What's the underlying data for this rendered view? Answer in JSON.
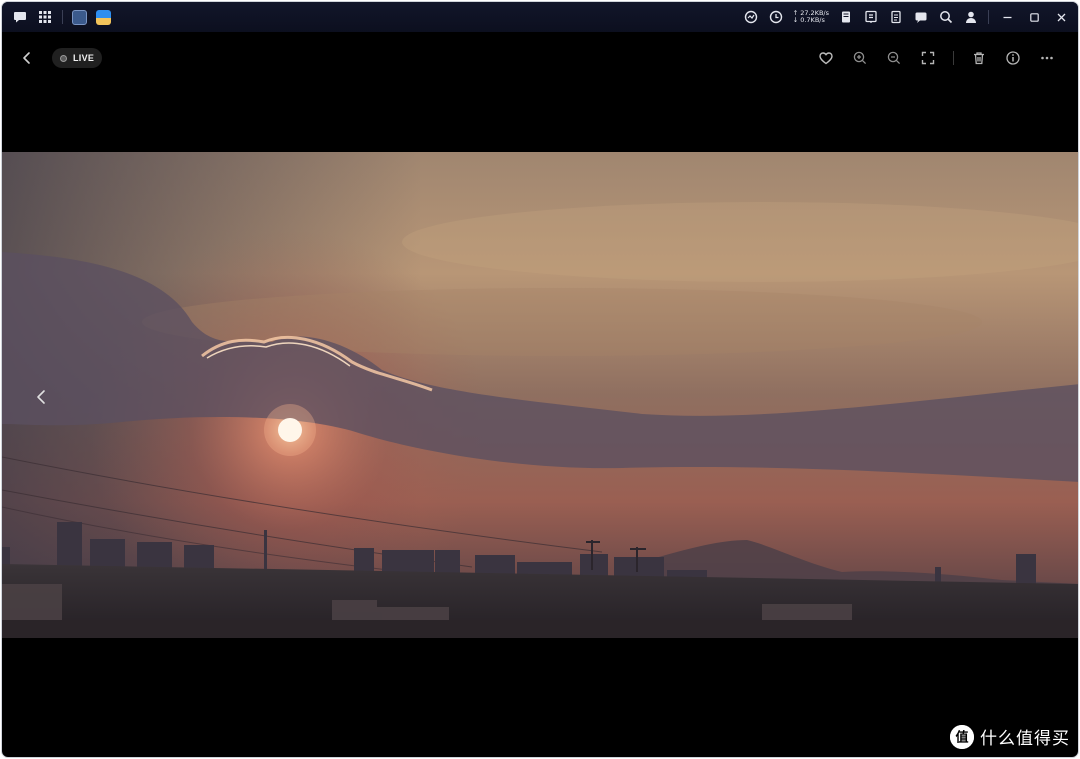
{
  "taskbar": {
    "net_up": "↑ 27.2KB/s",
    "net_down": "↓ 0.7KB/s",
    "left_icons": [
      "chat-icon",
      "app-grid-icon",
      "terminal-app-icon",
      "photos-app-icon"
    ],
    "right_icons": [
      "resource-monitor-icon",
      "clock-icon",
      "notes-icon",
      "notification-icon",
      "document-icon",
      "message-icon",
      "search-icon",
      "user-icon"
    ]
  },
  "viewer": {
    "live_label": "LIVE",
    "toolbar_icons": [
      "favorite-icon",
      "zoom-in-icon",
      "zoom-out-icon",
      "fullscreen-icon",
      "delete-icon",
      "info-icon",
      "more-icon"
    ]
  },
  "watermark": {
    "text": "什么值得买",
    "logo_glyph": "值"
  },
  "colors": {
    "window_bg": "#000000",
    "taskbar_bg": "#0f1326",
    "icon": "#d8dbe3",
    "toolbar_icon": "#9c9c9c"
  }
}
